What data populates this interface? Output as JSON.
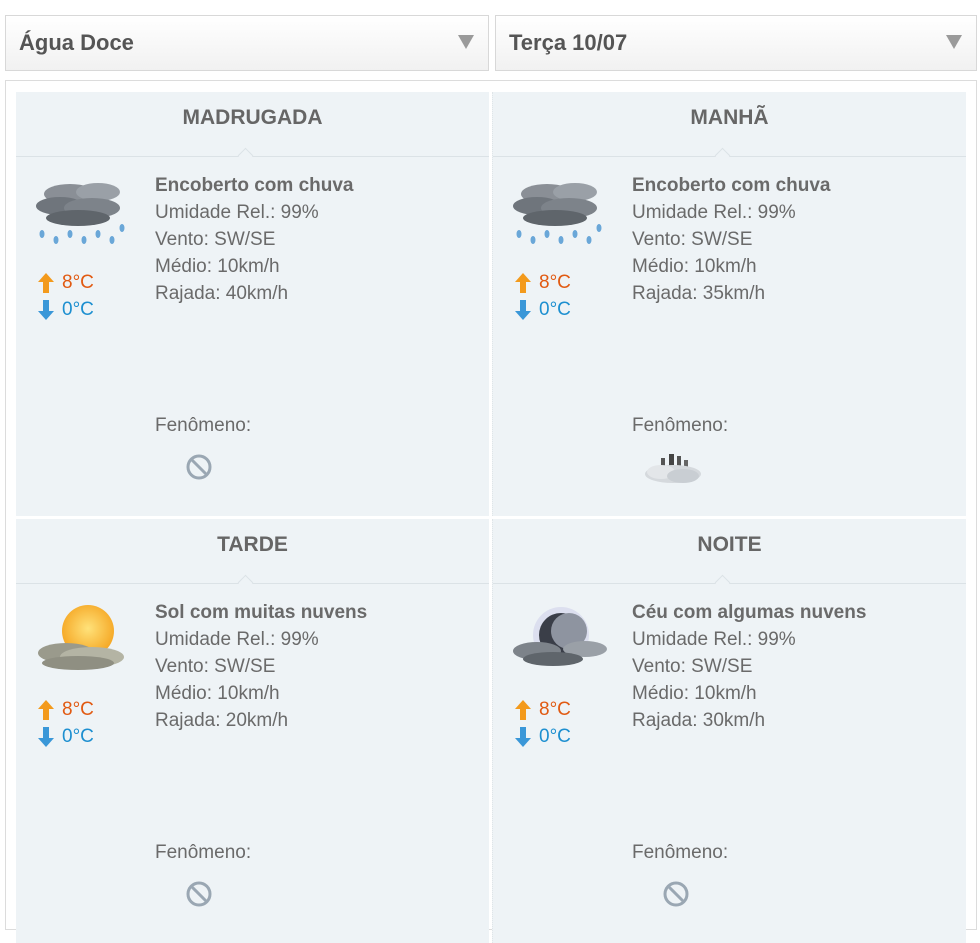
{
  "selectors": {
    "city": "Água Doce",
    "date": "Terça 10/07"
  },
  "periods": [
    {
      "title": "MADRUGADA",
      "icon": "overcast-rain-icon",
      "condition": "Encoberto com chuva",
      "humidity": "Umidade Rel.: 99%",
      "wind": "Vento: SW/SE",
      "avg": "Médio: 10km/h",
      "gust": "Rajada: 40km/h",
      "temp_max": "8°C",
      "temp_min": "0°C",
      "phenomenon_label": "Fenômeno:",
      "phenomenon_icon": "no-phenomenon-icon"
    },
    {
      "title": "MANHÃ",
      "icon": "overcast-rain-icon",
      "condition": "Encoberto com chuva",
      "humidity": "Umidade Rel.: 99%",
      "wind": "Vento: SW/SE",
      "avg": "Médio: 10km/h",
      "gust": "Rajada: 35km/h",
      "temp_max": "8°C",
      "temp_min": "0°C",
      "phenomenon_label": "Fenômeno:",
      "phenomenon_icon": "fog-phenomenon-icon"
    },
    {
      "title": "TARDE",
      "icon": "sun-with-clouds-icon",
      "condition": "Sol com muitas nuvens",
      "humidity": "Umidade Rel.: 99%",
      "wind": "Vento: SW/SE",
      "avg": "Médio: 10km/h",
      "gust": "Rajada: 20km/h",
      "temp_max": "8°C",
      "temp_min": "0°C",
      "phenomenon_label": "Fenômeno:",
      "phenomenon_icon": "no-phenomenon-icon"
    },
    {
      "title": "NOITE",
      "icon": "moon-with-clouds-icon",
      "condition": "Céu com algumas nuvens",
      "humidity": "Umidade Rel.: 99%",
      "wind": "Vento: SW/SE",
      "avg": "Médio: 10km/h",
      "gust": "Rajada: 30km/h",
      "temp_max": "8°C",
      "temp_min": "0°C",
      "phenomenon_label": "Fenômeno:",
      "phenomenon_icon": "no-phenomenon-icon"
    }
  ],
  "colors": {
    "panel_bg": "#eef3f6",
    "temp_max": "#e15a12",
    "temp_min": "#1d8fd0",
    "text": "#6a6a6a"
  }
}
